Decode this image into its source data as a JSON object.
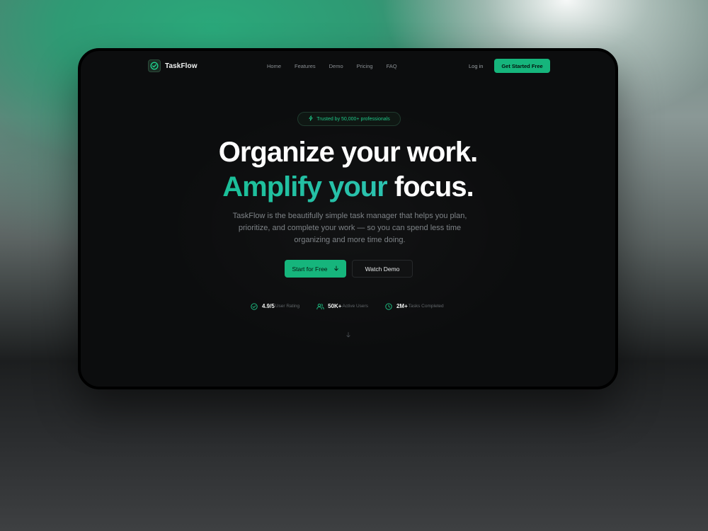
{
  "brand": {
    "name": "TaskFlow",
    "logo_icon": "check-circle-icon",
    "accent": "#16b57c"
  },
  "nav": {
    "links": [
      "Home",
      "Features",
      "Demo",
      "Pricing",
      "FAQ"
    ],
    "login": "Log in",
    "cta": "Get Started Free"
  },
  "hero": {
    "badge": "Trusted by 50,000+ professionals",
    "headline_line1": "Organize your work.",
    "headline_line2_accent": "Amplify your",
    "headline_line2_rest": " focus.",
    "subtitle": "TaskFlow is the beautifully simple task manager that helps you plan, prioritize, and complete your work — so you can spend less time organizing and more time doing.",
    "primary_button": "Start for Free",
    "secondary_button": "Watch Demo"
  },
  "stats": [
    {
      "value": "4.9/5",
      "label": "User Rating",
      "icon": "check-circle-icon"
    },
    {
      "value": "50K+",
      "label": "Active Users",
      "icon": "users-icon"
    },
    {
      "value": "2M+",
      "label": "Tasks Completed",
      "icon": "clock-icon"
    }
  ]
}
